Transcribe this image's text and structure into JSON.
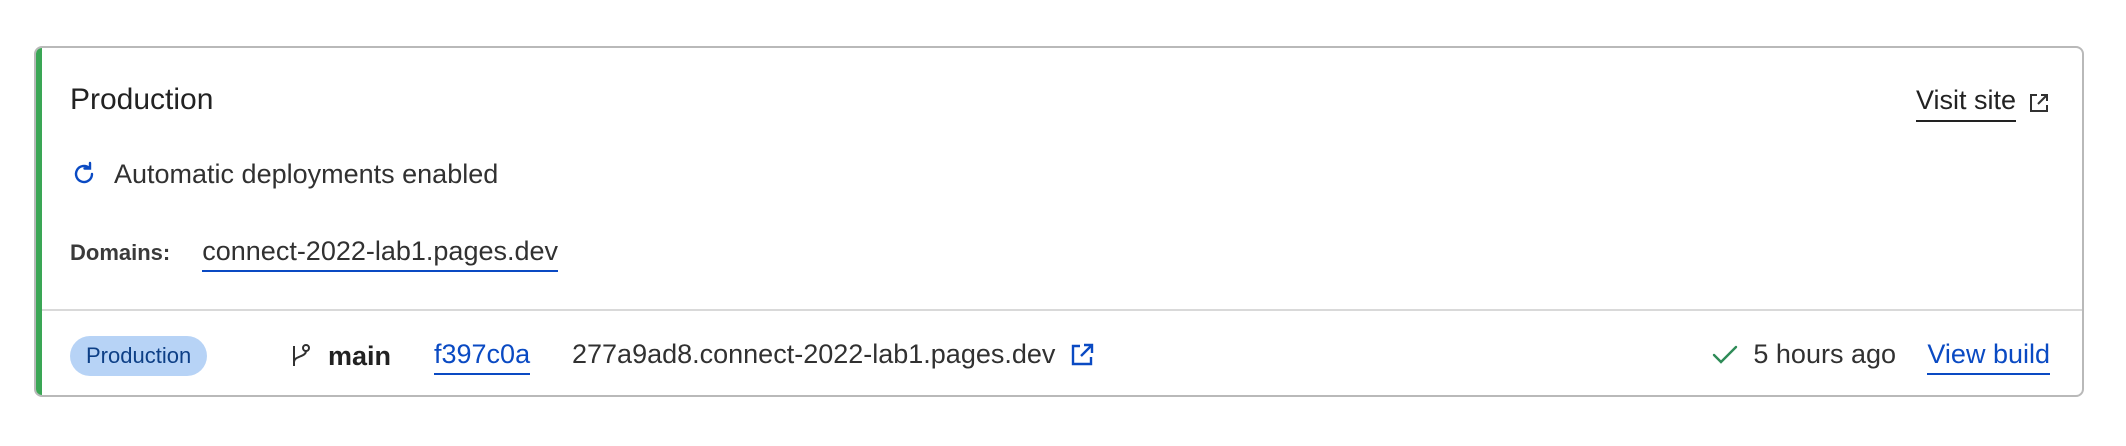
{
  "card": {
    "title": "Production",
    "visit_site_label": "Visit site",
    "auto_deploy_label": "Automatic deployments enabled",
    "domains_label": "Domains:",
    "domain": "connect-2022-lab1.pages.dev"
  },
  "deployment": {
    "environment_badge": "Production",
    "branch": "main",
    "commit": "f397c0a",
    "url": "277a9ad8.connect-2022-lab1.pages.dev",
    "time": "5 hours ago",
    "view_build_label": "View build"
  },
  "colors": {
    "accent": "#3aa655",
    "link": "#0a4ac3",
    "badge_bg": "#b7d3f6",
    "success": "#2e8b57"
  },
  "icons": {
    "visit_site": "external-link-icon",
    "auto_deploy": "refresh-icon",
    "branch": "git-branch-icon",
    "deploy_url": "external-link-icon",
    "status": "check-icon"
  }
}
